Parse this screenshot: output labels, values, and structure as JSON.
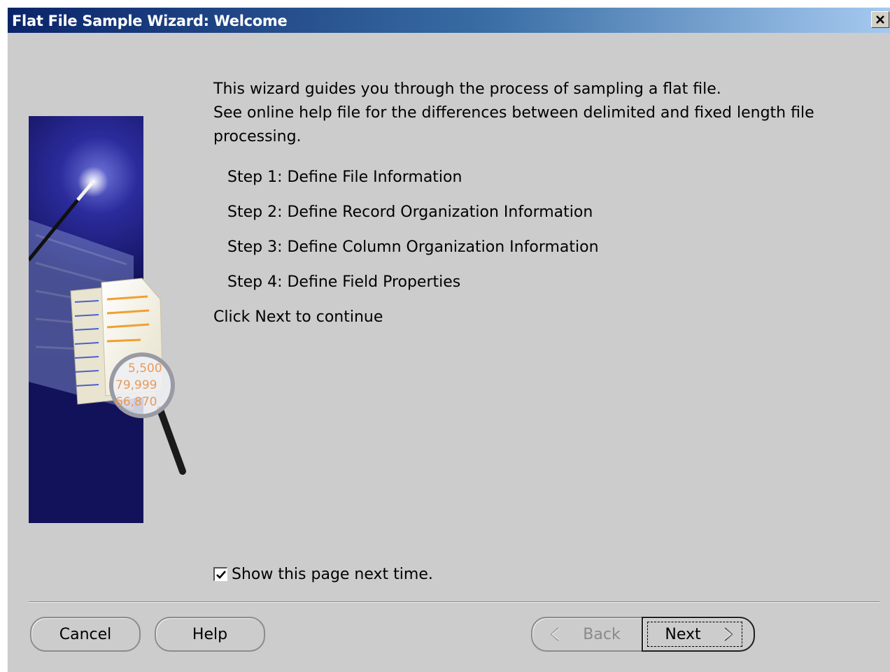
{
  "window": {
    "title": "Flat File Sample Wizard: Welcome",
    "close_icon": "close-icon"
  },
  "intro": {
    "line1": "This wizard guides you through the process of sampling a flat file.",
    "line2": "See online help file for the differences between delimited and fixed length file",
    "line3": "processing."
  },
  "steps": [
    {
      "label": "Step 1: Define File Information"
    },
    {
      "label": "Step 2: Define Record Organization Information"
    },
    {
      "label": "Step 3: Define Column Organization Information"
    },
    {
      "label": "Step 4: Define Field Properties"
    }
  ],
  "continue_text": "Click Next to continue",
  "show_page": {
    "label": "Show this page next time.",
    "checked": true
  },
  "buttons": {
    "cancel": "Cancel",
    "help": "Help",
    "back": "Back",
    "next": "Next"
  },
  "art": {
    "numbers": [
      "5,500",
      "79,999",
      "66,870"
    ]
  },
  "colors": {
    "dialog_bg": "#cccccc",
    "titlebar_start": "#0a246a",
    "titlebar_end": "#a6caf0",
    "art_bg": "#1a1a7a"
  }
}
